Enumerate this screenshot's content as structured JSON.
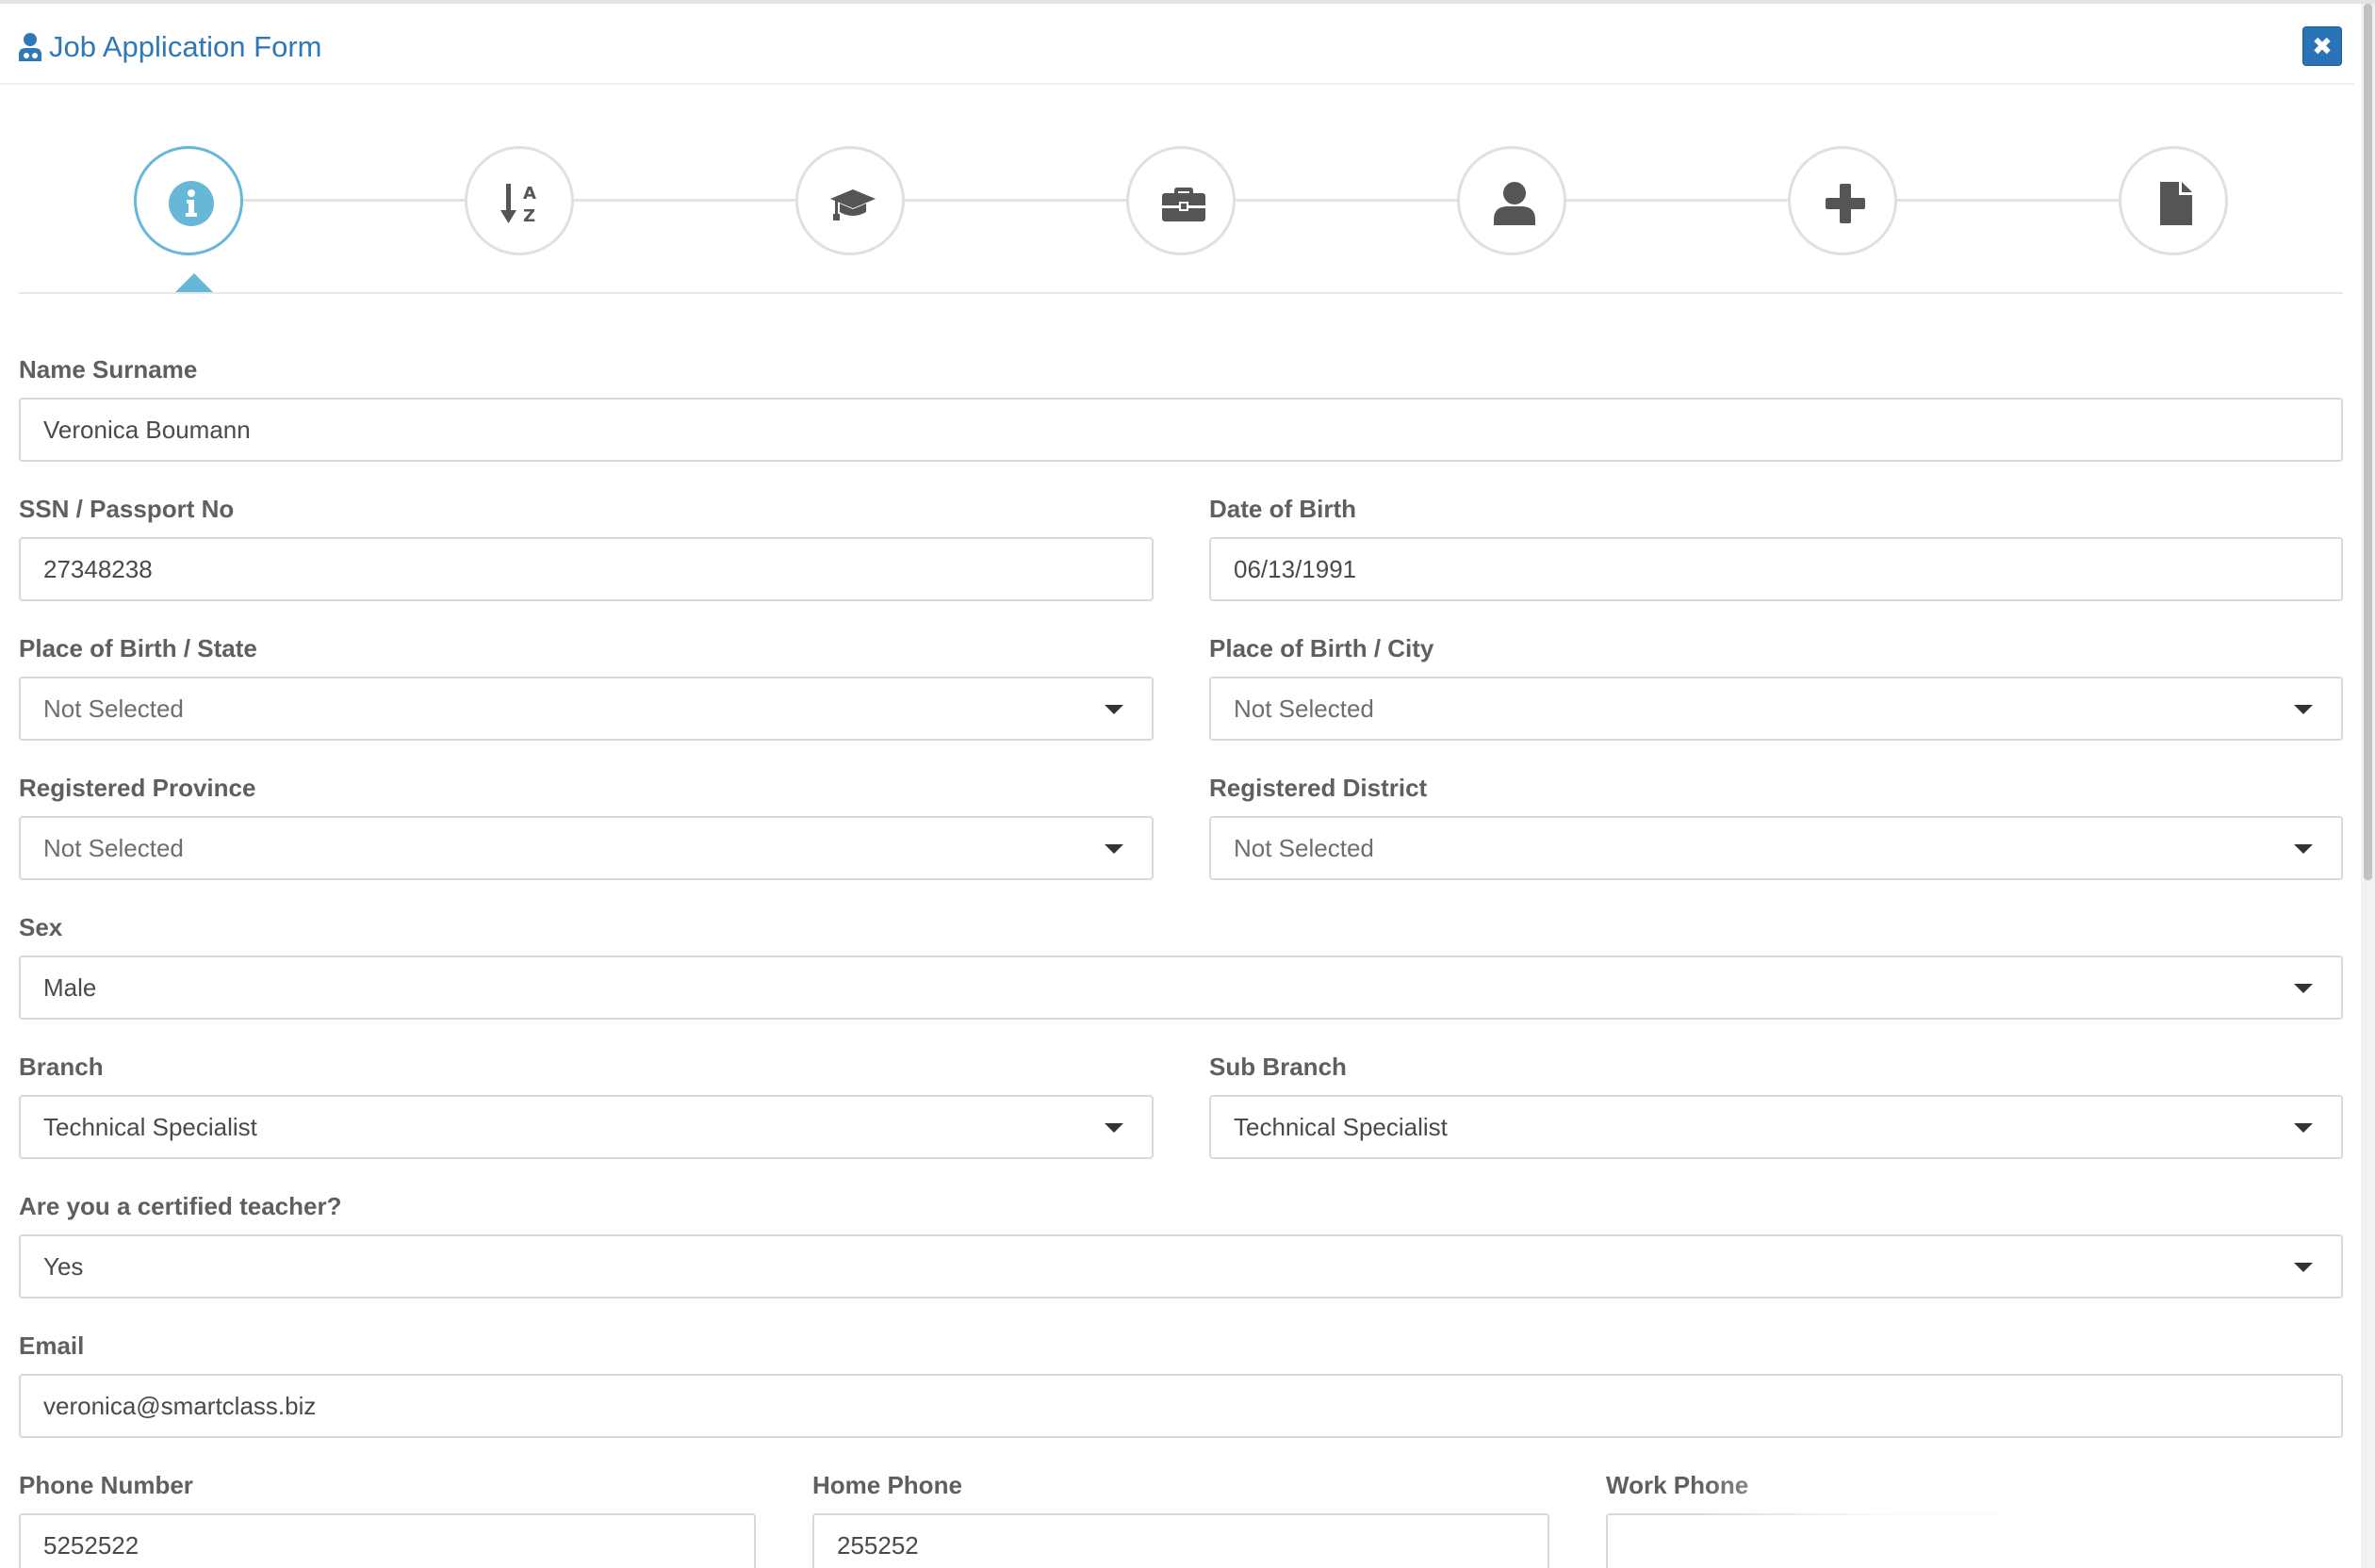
{
  "header": {
    "title": "Job Application Form",
    "close_symbol": "✖",
    "accent_color": "#2e78b7"
  },
  "steps": [
    {
      "icon": "info-icon",
      "active": true
    },
    {
      "icon": "sort-alpha-icon",
      "active": false
    },
    {
      "icon": "graduation-cap-icon",
      "active": false
    },
    {
      "icon": "briefcase-icon",
      "active": false
    },
    {
      "icon": "user-icon",
      "active": false
    },
    {
      "icon": "plus-icon",
      "active": false
    },
    {
      "icon": "document-icon",
      "active": false
    }
  ],
  "form": {
    "name_surname": {
      "label": "Name Surname",
      "value": "Veronica Boumann"
    },
    "ssn": {
      "label": "SSN / Passport No",
      "value": "27348238"
    },
    "dob": {
      "label": "Date of Birth",
      "value": "06/13/1991"
    },
    "birth_state": {
      "label": "Place of Birth / State",
      "value": "Not Selected"
    },
    "birth_city": {
      "label": "Place of Birth / City",
      "value": "Not Selected"
    },
    "reg_province": {
      "label": "Registered Province",
      "value": "Not Selected"
    },
    "reg_district": {
      "label": "Registered District",
      "value": "Not Selected"
    },
    "sex": {
      "label": "Sex",
      "value": "Male"
    },
    "branch": {
      "label": "Branch",
      "value": "Technical Specialist"
    },
    "sub_branch": {
      "label": "Sub Branch",
      "value": "Technical Specialist"
    },
    "certified": {
      "label": "Are you a certified teacher?",
      "value": "Yes"
    },
    "email": {
      "label": "Email",
      "value": "veronica@smartclass.biz"
    },
    "phone": {
      "label": "Phone Number",
      "value": "5252522"
    },
    "home_phone": {
      "label": "Home Phone",
      "value": "255252"
    },
    "work_phone": {
      "label": "Work Phone",
      "value": ""
    }
  }
}
